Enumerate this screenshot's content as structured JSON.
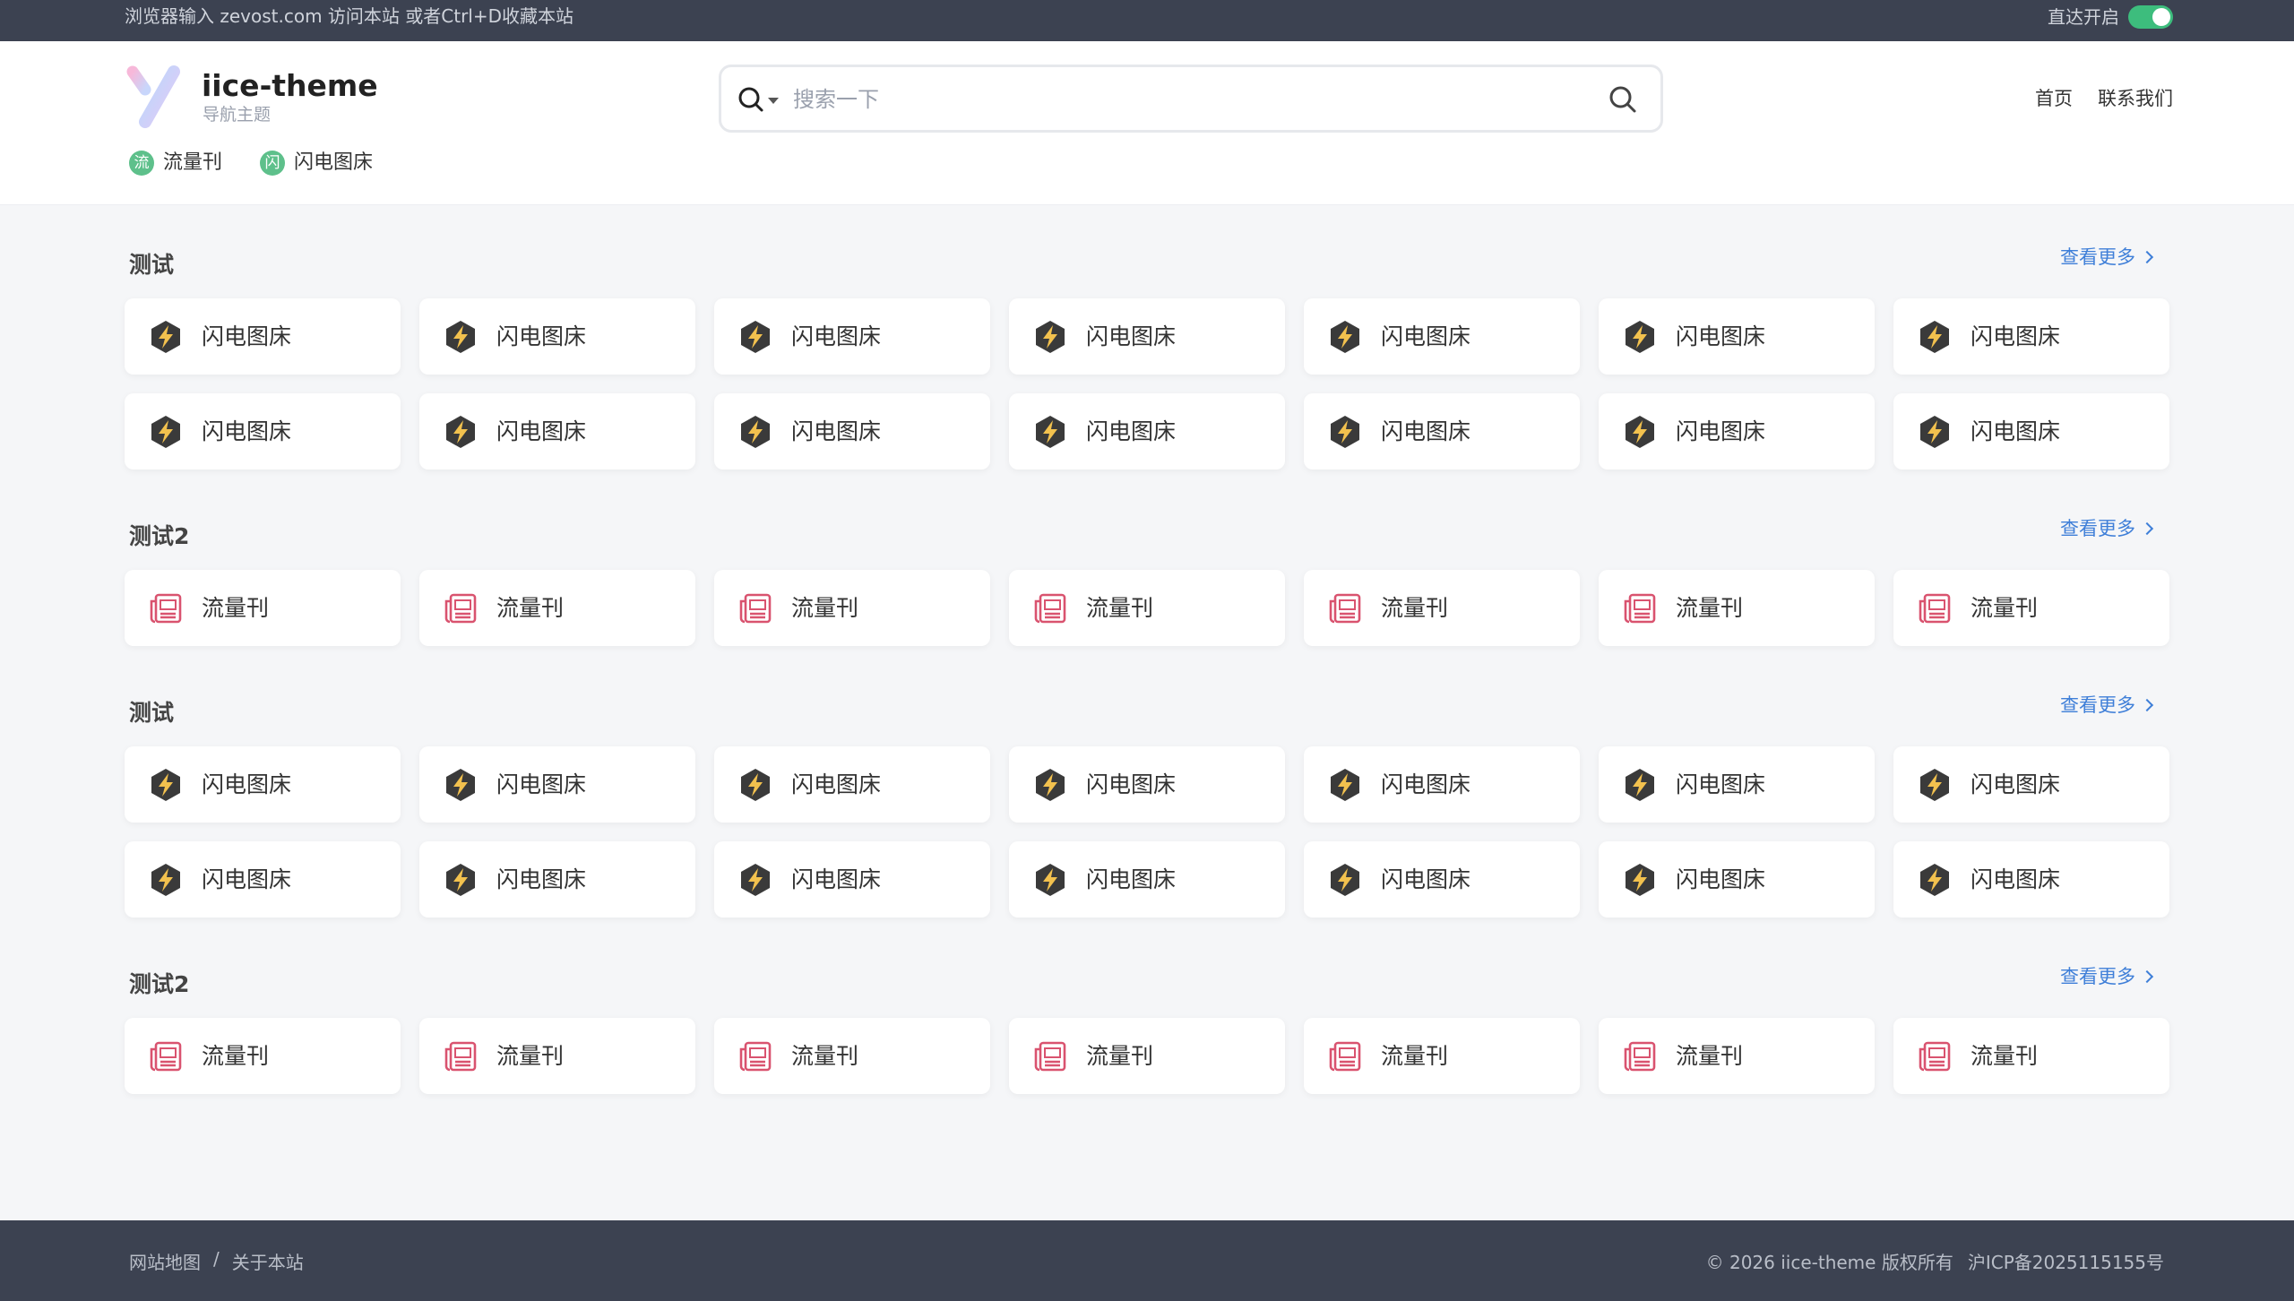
{
  "topbar": {
    "notice": "浏览器输入 zevost.com 访问本站 或者Ctrl+D收藏本站",
    "direct_label": "直达开启",
    "direct_on": true
  },
  "header": {
    "site_name": "iice-theme",
    "site_sub": "导航主题",
    "quick_links": [
      {
        "badge": "流",
        "label": "流量刊"
      },
      {
        "badge": "闪",
        "label": "闪电图床"
      }
    ],
    "search_placeholder": "搜索一下",
    "nav": [
      "首页",
      "联系我们"
    ]
  },
  "sections": [
    {
      "title": "测试",
      "more": "查看更多",
      "item": "闪电图床",
      "icon": "lightning-icon",
      "count": 14
    },
    {
      "title": "测试2",
      "more": "查看更多",
      "item": "流量刊",
      "icon": "newspaper-icon",
      "count": 7
    },
    {
      "title": "测试",
      "more": "查看更多",
      "item": "闪电图床",
      "icon": "lightning-icon",
      "count": 14
    },
    {
      "title": "测试2",
      "more": "查看更多",
      "item": "流量刊",
      "icon": "newspaper-icon",
      "count": 7
    }
  ],
  "footer": {
    "sitemap": "网站地图",
    "separator": "/",
    "about": "关于本站",
    "copyright": "© 2026 iice-theme 版权所有",
    "icp": "沪ICP备2025115155号"
  },
  "colors": {
    "topbar": "#3c4251",
    "accent_blue": "#3f7fd8",
    "toggle_green": "#3dbd7d",
    "badge_green": "#5ec08b",
    "news_pink": "#d9536f",
    "bolt_gold": "#f2c14e"
  }
}
